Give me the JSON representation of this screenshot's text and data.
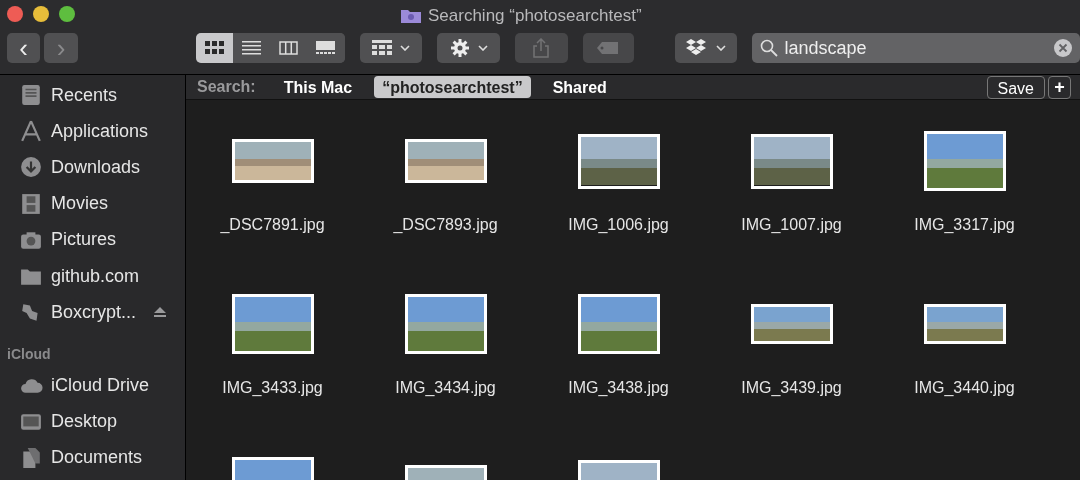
{
  "window": {
    "title": "Searching “photosearchtest”"
  },
  "toolbar": {
    "back": {
      "label": "‹",
      "disabled": false
    },
    "forward": {
      "label": "›",
      "disabled": true
    },
    "views": [
      {
        "selected": true
      },
      {
        "selected": false
      },
      {
        "selected": false
      },
      {
        "selected": false
      }
    ],
    "share": {
      "disabled": true
    },
    "tags": {
      "disabled": true
    },
    "search": {
      "value": "landscape"
    }
  },
  "sidebar": {
    "items": [
      {
        "label": "Recents"
      },
      {
        "label": "Applications"
      },
      {
        "label": "Downloads"
      },
      {
        "label": "Movies"
      },
      {
        "label": "Pictures"
      },
      {
        "label": "github.com"
      },
      {
        "label": "Boxcrypt...",
        "ejectable": true
      }
    ],
    "sections": [
      {
        "title": "iCloud",
        "items": [
          {
            "label": "iCloud Drive"
          },
          {
            "label": "Desktop"
          },
          {
            "label": "Documents"
          }
        ]
      }
    ]
  },
  "scope_bar": {
    "label": "Search:",
    "scopes": [
      {
        "label": "This Mac",
        "selected": false
      },
      {
        "label": "“photosearchtest”",
        "selected": true
      },
      {
        "label": "Shared",
        "selected": false
      }
    ],
    "save": "Save",
    "add": "+"
  },
  "files": [
    {
      "name": "_DSC7891.jpg",
      "kind": "desert"
    },
    {
      "name": "_DSC7893.jpg",
      "kind": "desert"
    },
    {
      "name": "IMG_1006.jpg",
      "kind": "valley"
    },
    {
      "name": "IMG_1007.jpg",
      "kind": "valley"
    },
    {
      "name": "IMG_3317.jpg",
      "kind": "hills"
    },
    {
      "name": "IMG_3433.jpg",
      "kind": "hills"
    },
    {
      "name": "IMG_3434.jpg",
      "kind": "hills"
    },
    {
      "name": "IMG_3438.jpg",
      "kind": "hills"
    },
    {
      "name": "IMG_3439.jpg",
      "kind": "wide"
    },
    {
      "name": "IMG_3440.jpg",
      "kind": "wide"
    },
    {
      "kind": "hills"
    },
    {
      "kind": "desert"
    },
    {
      "kind": "valley"
    }
  ]
}
